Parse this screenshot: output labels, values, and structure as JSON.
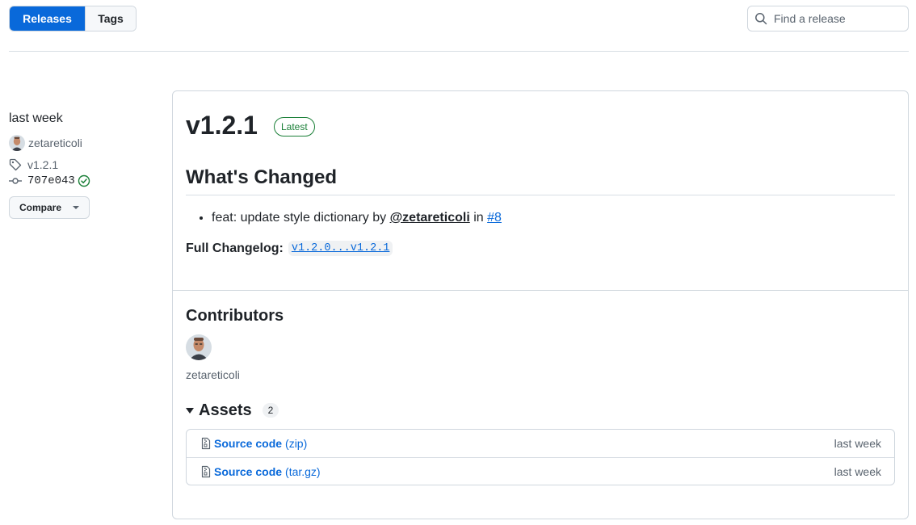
{
  "nav": {
    "releases_label": "Releases",
    "tags_label": "Tags",
    "search_placeholder": "Find a release"
  },
  "meta": {
    "when": "last week",
    "author": "zetareticoli",
    "tag": "v1.2.1",
    "commit": "707e043",
    "compare_label": "Compare"
  },
  "release": {
    "version": "v1.2.1",
    "latest_badge": "Latest",
    "whats_changed_heading": "What's Changed",
    "change_item": {
      "text": "feat: update style dictionary by",
      "mention": "@zetareticoli",
      "in": "in",
      "pr": "#8"
    },
    "full_changelog_label": "Full Changelog:",
    "full_changelog_link": "v1.2.0...v1.2.1"
  },
  "contributors": {
    "heading": "Contributors",
    "names": [
      "zetareticoli"
    ]
  },
  "assets": {
    "heading": "Assets",
    "count": "2",
    "items": [
      {
        "label": "Source code",
        "format": "(zip)",
        "time": "last week"
      },
      {
        "label": "Source code",
        "format": "(tar.gz)",
        "time": "last week"
      }
    ]
  },
  "colors": {
    "accent": "#0969da",
    "success": "#1a7f37",
    "border": "#d0d7de"
  }
}
